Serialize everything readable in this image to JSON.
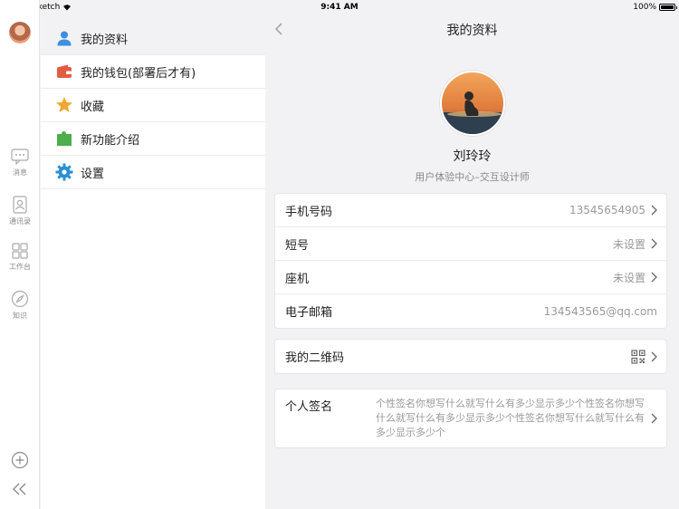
{
  "status_bar": {
    "carrier": "Sketch",
    "time": "9:41 AM",
    "battery": "100%"
  },
  "rail": {
    "items": [
      {
        "label": "消息",
        "icon": "chat-icon"
      },
      {
        "label": "通讯录",
        "icon": "contacts-icon"
      },
      {
        "label": "工作台",
        "icon": "grid-icon"
      },
      {
        "label": "知识",
        "icon": "compass-icon"
      }
    ]
  },
  "menu": {
    "items": [
      {
        "label": "我的资料",
        "icon": "user-icon",
        "color": "#3d8fe0"
      },
      {
        "label": "我的钱包(部署后才有)",
        "icon": "wallet-icon",
        "color": "#e25c42"
      },
      {
        "label": "收藏",
        "icon": "star-icon",
        "color": "#f0a630"
      },
      {
        "label": "新功能介绍",
        "icon": "puzzle-icon",
        "color": "#4cae4c"
      },
      {
        "label": "设置",
        "icon": "gear-icon",
        "color": "#2a8fd6"
      }
    ]
  },
  "main": {
    "title": "我的资料",
    "profile": {
      "name": "刘玲玲",
      "department": "用户体验中心–交互设计师"
    },
    "contact_rows": [
      {
        "label": "手机号码",
        "value": "13545654905"
      },
      {
        "label": "短号",
        "value": "未设置"
      },
      {
        "label": "座机",
        "value": "未设置"
      },
      {
        "label": "电子邮箱",
        "value": "134543565@qq.com"
      }
    ],
    "qr_row": {
      "label": "我的二维码"
    },
    "signature": {
      "label": "个人签名",
      "text": "个性签名你想写什么就写什么有多少显示多少个性签名你想写什么就写什么有多少显示多少个性签名你想写什么就写什么有多少显示多少个"
    }
  }
}
